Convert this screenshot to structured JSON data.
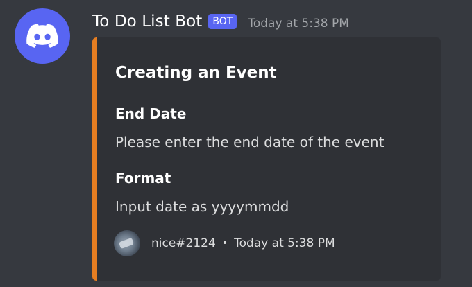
{
  "message": {
    "username": "To Do List Bot",
    "bot_tag": "BOT",
    "timestamp": "Today at 5:38 PM",
    "avatar_icon": "discord-logo-icon"
  },
  "embed": {
    "accent_color": "#e67e22",
    "title": "Creating an Event",
    "fields": [
      {
        "name": "End Date",
        "value": "Please enter the end date of the event"
      },
      {
        "name": "Format",
        "value": "Input date as yyyymmdd"
      }
    ],
    "footer": {
      "author": "nice#2124",
      "separator": "•",
      "timestamp": "Today at 5:38 PM"
    }
  },
  "colors": {
    "background": "#36393f",
    "embed_background": "#2f3136",
    "blurple": "#5865f2"
  }
}
